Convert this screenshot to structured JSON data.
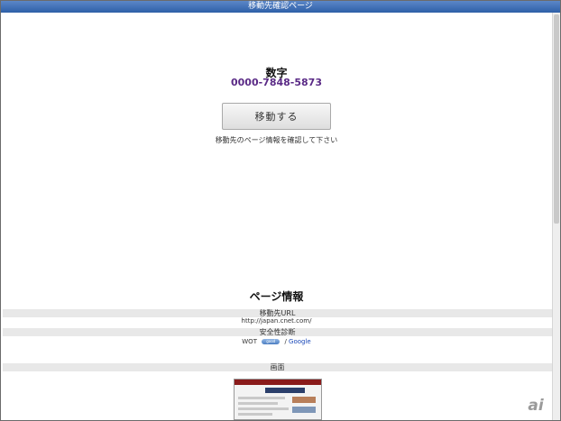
{
  "window": {
    "title": "移動先確認ページ"
  },
  "main": {
    "number_label": "数字",
    "number_value": "0000-7848-5873",
    "move_button_label": "移動する",
    "hint": "移動先のページ情報を確認して下さい"
  },
  "page_info": {
    "title": "ページ情報",
    "url_header": "移動先URL",
    "url": "http://japan.cnet.com/",
    "safety_header": "安全性診断",
    "wot_label": "WOT",
    "wot_badge": "good",
    "separator": "/",
    "google_link": "Google",
    "screen_header": "画面"
  },
  "watermark": "ai"
}
